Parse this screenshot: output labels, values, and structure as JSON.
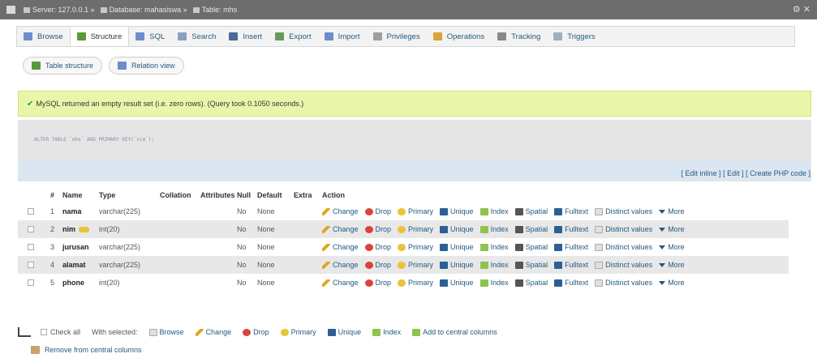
{
  "topbar": {
    "crumbs": [
      {
        "label": "Server: 127.0.0.1",
        "icon": "server-icon"
      },
      {
        "label": "Database: mahasiswa",
        "icon": "database-icon"
      },
      {
        "label": "Table: mhs",
        "icon": "table-icon"
      }
    ],
    "gear_icon": "gear-icon"
  },
  "tabs": [
    {
      "label": "Browse",
      "icon": "browse-icon",
      "color": "#6b8fc7"
    },
    {
      "label": "Structure",
      "icon": "structure-icon",
      "color": "#5a9a3a",
      "active": true
    },
    {
      "label": "SQL",
      "icon": "sql-icon",
      "color": "#6b8fc7"
    },
    {
      "label": "Search",
      "icon": "search-icon",
      "color": "#8aa0c0"
    },
    {
      "label": "Insert",
      "icon": "insert-icon",
      "color": "#4a6a9a"
    },
    {
      "label": "Export",
      "icon": "export-icon",
      "color": "#6a9a5a"
    },
    {
      "label": "Import",
      "icon": "import-icon",
      "color": "#6b8fc7"
    },
    {
      "label": "Privileges",
      "icon": "privileges-icon",
      "color": "#9aa0a0"
    },
    {
      "label": "Operations",
      "icon": "operations-icon",
      "color": "#d9a43a"
    },
    {
      "label": "Tracking",
      "icon": "tracking-icon",
      "color": "#8a8a8a"
    },
    {
      "label": "Triggers",
      "icon": "triggers-icon",
      "color": "#9ab0c0"
    }
  ],
  "subtabs": [
    {
      "label": "Table structure",
      "icon": "table-structure-icon"
    },
    {
      "label": "Relation view",
      "icon": "relation-view-icon"
    }
  ],
  "success_message": "MySQL returned an empty result set (i.e. zero rows). (Query took 0.1050 seconds.)",
  "sql_query": "ALTER TABLE `mhs` ADD PRIMARY KEY(`nim`);",
  "sql_links": {
    "edit_inline": "[ Edit inline ]",
    "edit": "[ Edit ]",
    "create_php": "[ Create PHP code ]"
  },
  "columns_header": [
    "#",
    "Name",
    "Type",
    "Collation",
    "Attributes",
    "Null",
    "Default",
    "Extra",
    "Action"
  ],
  "rows": [
    {
      "num": "1",
      "name": "nama",
      "type": "varchar(225)",
      "null": "No",
      "default": "None",
      "primary": false
    },
    {
      "num": "2",
      "name": "nim",
      "type": "int(20)",
      "null": "No",
      "default": "None",
      "primary": true
    },
    {
      "num": "3",
      "name": "jurusan",
      "type": "varchar(225)",
      "null": "No",
      "default": "None",
      "primary": false
    },
    {
      "num": "4",
      "name": "alamat",
      "type": "varchar(225)",
      "null": "No",
      "default": "None",
      "primary": false
    },
    {
      "num": "5",
      "name": "phone",
      "type": "int(20)",
      "null": "No",
      "default": "None",
      "primary": false
    }
  ],
  "row_actions": [
    {
      "label": "Change",
      "icon": "pencil-icon"
    },
    {
      "label": "Drop",
      "icon": "drop-icon"
    },
    {
      "label": "Primary",
      "icon": "key-icon"
    },
    {
      "label": "Unique",
      "icon": "unique-icon"
    },
    {
      "label": "Index",
      "icon": "index-icon"
    },
    {
      "label": "Spatial",
      "icon": "spatial-icon"
    },
    {
      "label": "Fulltext",
      "icon": "fulltext-icon"
    },
    {
      "label": "Distinct values",
      "icon": "distinct-values-icon"
    },
    {
      "label": "More",
      "icon": "chevron-down-icon"
    }
  ],
  "footer": {
    "check_all": "Check all",
    "with_selected": "With selected:",
    "actions": [
      {
        "label": "Browse",
        "icon": "browse-icon"
      },
      {
        "label": "Change",
        "icon": "pencil-icon"
      },
      {
        "label": "Drop",
        "icon": "drop-icon"
      },
      {
        "label": "Primary",
        "icon": "key-icon"
      },
      {
        "label": "Unique",
        "icon": "unique-icon"
      },
      {
        "label": "Index",
        "icon": "index-icon"
      },
      {
        "label": "Add to central columns",
        "icon": "add-central-columns-icon"
      }
    ],
    "remove_central": "Remove from central columns"
  }
}
